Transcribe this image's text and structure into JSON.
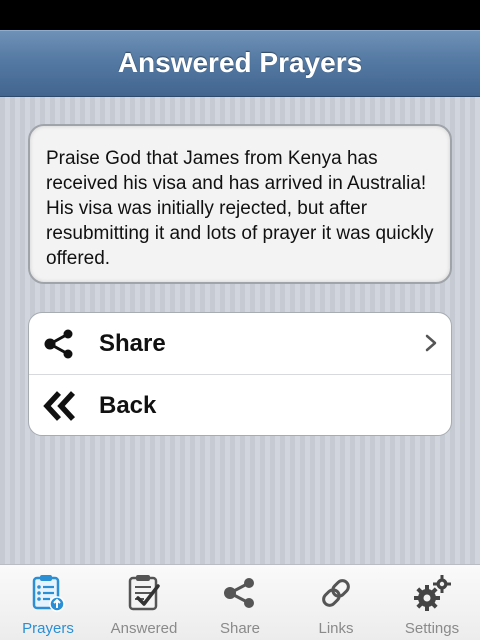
{
  "nav": {
    "title": "Answered Prayers"
  },
  "message": {
    "text": "Praise God that James from Kenya has received his visa and has arrived in Australia! His visa was initially rejected, but after resubmitting it and lots of prayer it was quickly offered."
  },
  "actions": [
    {
      "label": "Share",
      "icon": "share-icon",
      "has_chevron": true
    },
    {
      "label": "Back",
      "icon": "double-chevron-left-icon",
      "has_chevron": false
    }
  ],
  "tabs": [
    {
      "label": "Prayers",
      "icon": "prayer-list-icon",
      "active": true
    },
    {
      "label": "Answered",
      "icon": "answered-checklist-icon",
      "active": false
    },
    {
      "label": "Share",
      "icon": "share-icon",
      "active": false
    },
    {
      "label": "Links",
      "icon": "link-icon",
      "active": false
    },
    {
      "label": "Settings",
      "icon": "gears-icon",
      "active": false
    }
  ],
  "colors": {
    "nav_bar": "#557aa3",
    "active_tab": "#2a8fd4",
    "inactive_tab": "#8a8a8a",
    "background": "#c9cdd6"
  }
}
